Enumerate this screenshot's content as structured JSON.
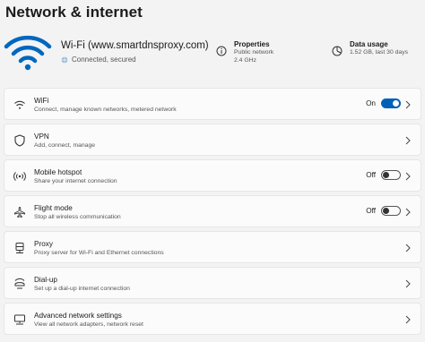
{
  "page_title": "Network & internet",
  "summary": {
    "network_name": "Wi-Fi (www.smartdnsproxy.com)",
    "status": "Connected, secured",
    "properties": {
      "title": "Properties",
      "line1": "Public network",
      "line2": "2.4 GHz"
    },
    "data_usage": {
      "title": "Data usage",
      "line1": "1.52 GB, last 30 days"
    }
  },
  "items": [
    {
      "title": "WiFi",
      "subtitle": "Connect, manage known networks, metered network",
      "icon": "wifi-icon",
      "toggle": "On"
    },
    {
      "title": "VPN",
      "subtitle": "Add, connect, manage",
      "icon": "shield-icon"
    },
    {
      "title": "Mobile hotspot",
      "subtitle": "Share your internet connection",
      "icon": "hotspot-icon",
      "toggle": "Off"
    },
    {
      "title": "Flight mode",
      "subtitle": "Stop all wireless communication",
      "icon": "airplane-icon",
      "toggle": "Off"
    },
    {
      "title": "Proxy",
      "subtitle": "Proxy server for Wi-Fi and Ethernet connections",
      "icon": "server-icon"
    },
    {
      "title": "Dial-up",
      "subtitle": "Set up a dial-up internet connection",
      "icon": "dialup-icon"
    },
    {
      "title": "Advanced network settings",
      "subtitle": "View all network adapters, network reset",
      "icon": "network-adapter-icon"
    }
  ],
  "colors": {
    "accent": "#005fb8",
    "wifi_icon": "#0067c0"
  }
}
